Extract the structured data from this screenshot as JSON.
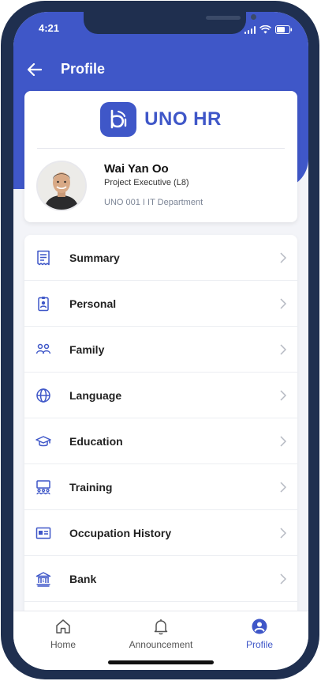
{
  "status_bar": {
    "time": "4:21"
  },
  "header": {
    "title": "Profile"
  },
  "brand": {
    "name": "UNO HR",
    "color": "#3f57c8"
  },
  "employee": {
    "name": "Wai Yan Oo",
    "role": "Project Executive (L8)",
    "meta": "UNO 001  I  IT Department"
  },
  "menu": {
    "items": [
      {
        "label": "Summary",
        "icon": "receipt-icon"
      },
      {
        "label": "Personal",
        "icon": "id-badge-icon"
      },
      {
        "label": "Family",
        "icon": "people-icon"
      },
      {
        "label": "Language",
        "icon": "globe-icon"
      },
      {
        "label": "Education",
        "icon": "graduation-cap-icon"
      },
      {
        "label": "Training",
        "icon": "training-icon"
      },
      {
        "label": "Occupation History",
        "icon": "id-card-icon"
      },
      {
        "label": "Bank",
        "icon": "bank-icon"
      }
    ]
  },
  "tabbar": {
    "items": [
      {
        "label": "Home",
        "icon": "home-icon",
        "active": false
      },
      {
        "label": "Announcement",
        "icon": "bell-icon",
        "active": false
      },
      {
        "label": "Profile",
        "icon": "user-circle-icon",
        "active": true
      }
    ]
  }
}
